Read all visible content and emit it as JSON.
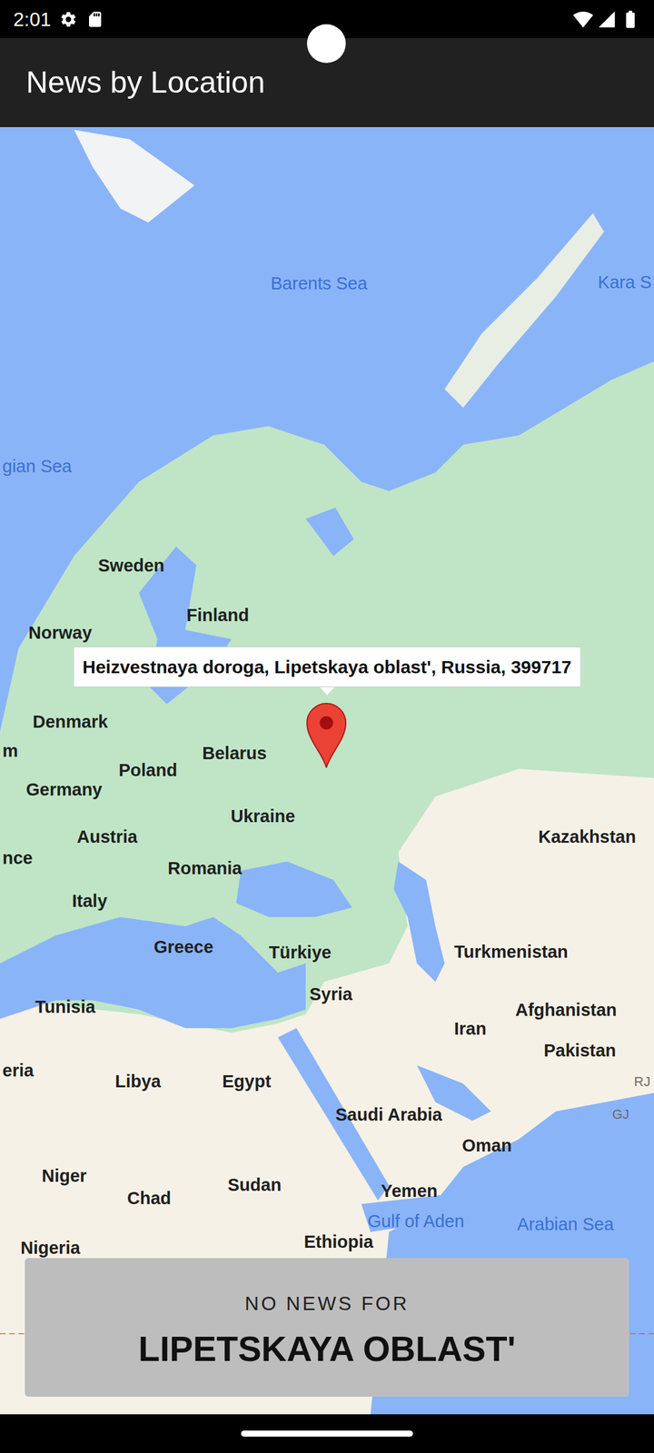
{
  "status_bar": {
    "time": "2:01"
  },
  "app_bar": {
    "title": "News by Location"
  },
  "map": {
    "labels": [
      {
        "text": "Barents Sea",
        "kind": "sea"
      },
      {
        "text": "Kara S",
        "kind": "sea"
      },
      {
        "text": "gian Sea",
        "kind": "sea"
      },
      {
        "text": "Sweden",
        "kind": "country"
      },
      {
        "text": "Finland",
        "kind": "country"
      },
      {
        "text": "Norway",
        "kind": "country"
      },
      {
        "text": "Denmark",
        "kind": "country"
      },
      {
        "text": "m",
        "kind": "country"
      },
      {
        "text": "Belarus",
        "kind": "country"
      },
      {
        "text": "Poland",
        "kind": "country"
      },
      {
        "text": "Germany",
        "kind": "country"
      },
      {
        "text": "Ukraine",
        "kind": "country"
      },
      {
        "text": "Kazakhstan",
        "kind": "country"
      },
      {
        "text": "Austria",
        "kind": "country"
      },
      {
        "text": "nce",
        "kind": "country"
      },
      {
        "text": "Romania",
        "kind": "country"
      },
      {
        "text": "Italy",
        "kind": "country"
      },
      {
        "text": "Greece",
        "kind": "country"
      },
      {
        "text": "Türkiye",
        "kind": "country"
      },
      {
        "text": "Turkmenistan",
        "kind": "country"
      },
      {
        "text": "Syria",
        "kind": "country"
      },
      {
        "text": "Tunisia",
        "kind": "country"
      },
      {
        "text": "Afghanistan",
        "kind": "country"
      },
      {
        "text": "Iran",
        "kind": "country"
      },
      {
        "text": "Pakistan",
        "kind": "country"
      },
      {
        "text": "RJ",
        "kind": "code"
      },
      {
        "text": "eria",
        "kind": "country"
      },
      {
        "text": "Libya",
        "kind": "country"
      },
      {
        "text": "Egypt",
        "kind": "country"
      },
      {
        "text": "Saudi Arabia",
        "kind": "country"
      },
      {
        "text": "GJ",
        "kind": "code"
      },
      {
        "text": "Oman",
        "kind": "country"
      },
      {
        "text": "Niger",
        "kind": "country"
      },
      {
        "text": "Sudan",
        "kind": "country"
      },
      {
        "text": "Yemen",
        "kind": "country"
      },
      {
        "text": "Chad",
        "kind": "country"
      },
      {
        "text": "Gulf of Aden",
        "kind": "sea"
      },
      {
        "text": "Arabian Sea",
        "kind": "sea"
      },
      {
        "text": "Nigeria",
        "kind": "country"
      },
      {
        "text": "Ethiopia",
        "kind": "country"
      }
    ],
    "marker": {
      "title": "Heizvestnaya doroga, Lipetskaya oblast', Russia, 399717"
    }
  },
  "news_panel": {
    "caption": "NO NEWS FOR",
    "region": "LIPETSKAYA OBLAST'"
  }
}
